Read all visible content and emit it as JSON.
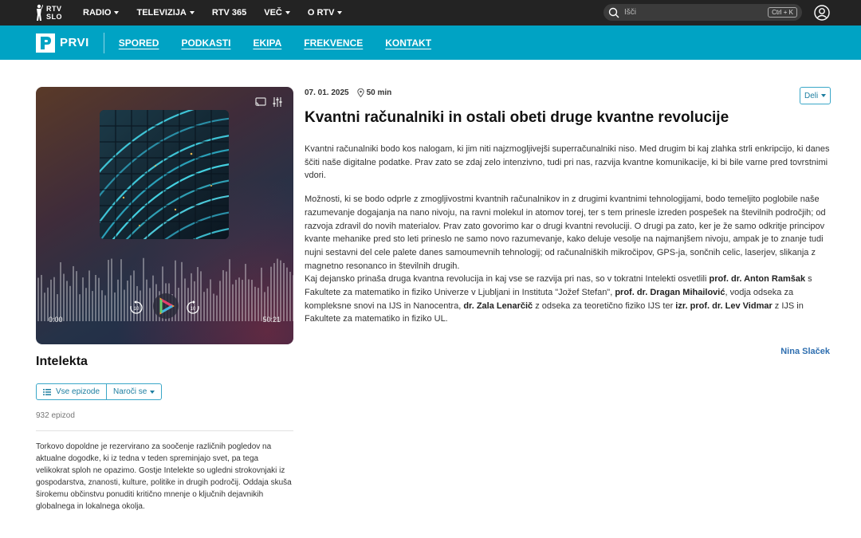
{
  "topbar": {
    "logo_line1": "RTV",
    "logo_line2": "SLO",
    "nav": [
      {
        "label": "RADIO",
        "dropdown": true
      },
      {
        "label": "TELEVIZIJA",
        "dropdown": true
      },
      {
        "label": "RTV 365",
        "dropdown": false
      },
      {
        "label": "VEČ",
        "dropdown": true
      },
      {
        "label": "O RTV",
        "dropdown": true
      }
    ],
    "search_placeholder": "Išči",
    "search_shortcut": "Ctrl + K"
  },
  "brandbar": {
    "logo_text": "PRVI",
    "nav": [
      "SPORED",
      "PODKASTI",
      "EKIPA",
      "FREKVENCE",
      "KONTAKT"
    ]
  },
  "player": {
    "time_current": "0:00",
    "time_total": "50:21",
    "skip_back_label": "10",
    "skip_forward_label": "10"
  },
  "show": {
    "title": "Intelekta",
    "all_episodes_label": "Vse epizode",
    "subscribe_label": "Naroči se",
    "episode_count": "932 epizod",
    "description": "Torkovo dopoldne je rezervirano za soočenje različnih pogledov na aktualne dogodke, ki iz tedna v teden spreminjajo svet, pa tega velikokrat sploh ne opazimo. Gostje Intelekte so ugledni strokovnjaki iz gospodarstva, znanosti, kulture, politike in drugih področij. Oddaja skuša širokemu občinstvu ponuditi kritično mnenje o ključnih dejavnikih globalnega in lokalnega okolja."
  },
  "episode": {
    "date": "07. 01. 2025",
    "duration": "50 min",
    "share_label": "Deli",
    "title": "Kvantni računalniki in ostali obeti druge kvantne revolucije",
    "paragraph1": "Kvantni računalniki bodo kos nalogam, ki jim niti najzmogljivejši superračunalniki niso. Med drugim bi kaj zlahka strli enkripcijo, ki danes ščiti naše digitalne podatke. Prav zato se zdaj zelo intenzivno, tudi pri nas, razvija kvantne komunikacije, ki bi bile varne pred tovrstnimi vdori.",
    "paragraph2": "Možnosti, ki se bodo odprle z zmogljivostmi kvantnih računalnikov in z drugimi kvantnimi tehnologijami, bodo temeljito poglobile naše razumevanje dogajanja na nano nivoju, na ravni molekul in atomov torej, ter s tem prinesle izreden pospešek na številnih področjih; od razvoja zdravil do novih materialov. Prav zato govorimo kar o drugi kvantni revoluciji. O drugi pa zato, ker je že samo odkritje principov kvante mehanike pred sto leti prineslo ne samo novo razumevanje, kako deluje vesolje na najmanjšem nivoju, ampak je to znanje tudi nujni sestavni del cele palete danes samoumevnih tehnologij; od računalniških mikročipov, GPS-ja, sončnih celic, laserjev, slikanja z magnetno resonanco in številnih drugih.",
    "p3_a": "Kaj dejansko prinaša druga kvantna revolucija in kaj vse se razvija pri nas, so v tokratni Intelekti osvetlili ",
    "guest1": "prof. dr. Anton Ramšak",
    "p3_b": " s Fakultete za matematiko in fiziko Univerze v Ljubljani in Instituta \"Jožef Stefan\", ",
    "guest2": "prof. dr. Dragan Mihailović",
    "p3_c": ", vodja odseka za kompleksne snovi na IJS in Nanocentra, ",
    "guest3": "dr. Zala Lenarčič",
    "p3_d": " z odseka za teoretično fiziko IJS ter ",
    "guest4": "izr. prof. dr. Lev Vidmar",
    "p3_e": " z IJS in Fakultete za matematiko in fiziko UL.",
    "author": "Nina Slaček"
  },
  "colors": {
    "topbar_bg": "#232323",
    "brand_teal": "#00a3c4",
    "link_blue": "#2f6fb0",
    "button_border": "#3aa7c8"
  }
}
